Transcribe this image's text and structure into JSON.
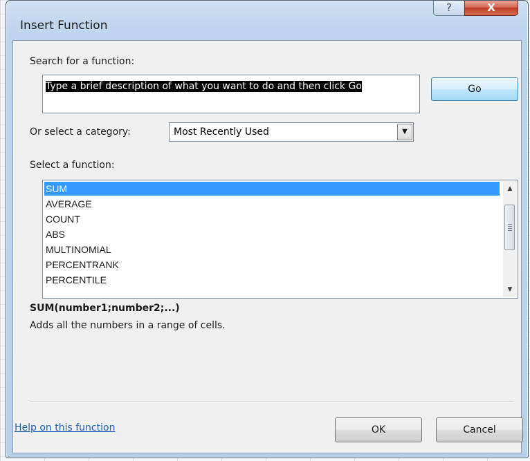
{
  "window": {
    "title": "Insert Function",
    "help_glyph": "?",
    "close_glyph": "X"
  },
  "search": {
    "label": "Search for a function:",
    "value": "Type a brief description of what you want to do and then click Go",
    "go_label": "Go"
  },
  "category": {
    "label": "Or select a category:",
    "selected": "Most Recently Used"
  },
  "functions": {
    "label": "Select a function:",
    "items": [
      "SUM",
      "AVERAGE",
      "COUNT",
      "ABS",
      "MULTINOMIAL",
      "PERCENTRANK",
      "PERCENTILE"
    ],
    "selected": "SUM"
  },
  "details": {
    "signature": "SUM(number1;number2;...)",
    "description": "Adds all the numbers in a range of cells."
  },
  "footer": {
    "help_link": "Help on this function",
    "ok_label": "OK",
    "cancel_label": "Cancel"
  },
  "icons": {
    "help": "question-mark-icon",
    "close": "close-icon",
    "dropdown": "chevron-down-icon",
    "scroll_up": "scroll-up-icon",
    "scroll_down": "scroll-down-icon"
  },
  "colors": {
    "selection": "#3399ff",
    "link": "#1d5dbb",
    "close_button": "#c0402a"
  }
}
